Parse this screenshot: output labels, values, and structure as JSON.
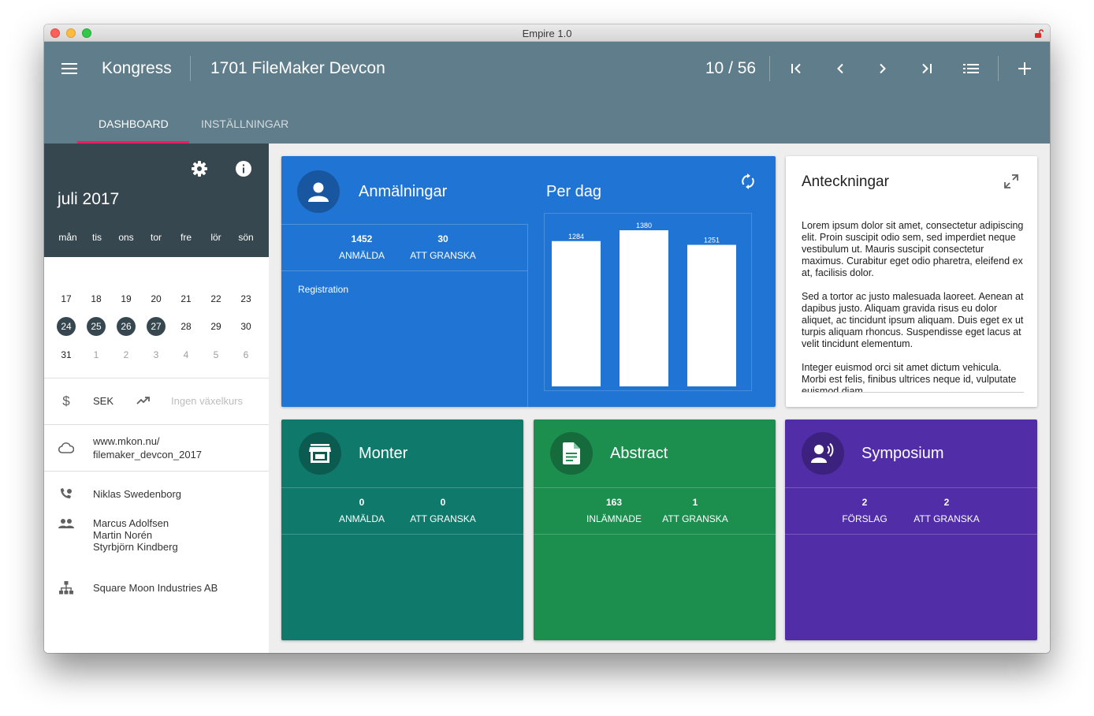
{
  "window": {
    "title": "Empire 1.0"
  },
  "appbar": {
    "app_name": "Kongress",
    "record_title": "1701  FileMaker Devcon",
    "counter": "10 / 56",
    "tabs": [
      {
        "label": "DASHBOARD",
        "active": true
      },
      {
        "label": "INSTÄLLNINGAR",
        "active": false
      }
    ],
    "background_color": "#607d8b",
    "tab_indicator_color": "#e91e63"
  },
  "calendar": {
    "month": "juli 2017",
    "weekdays": [
      "mån",
      "tis",
      "ons",
      "tor",
      "fre",
      "lör",
      "sön"
    ],
    "weeks": [
      [
        "17",
        "18",
        "19",
        "20",
        "21",
        "22",
        "23"
      ],
      [
        "24",
        "25",
        "26",
        "27",
        "28",
        "29",
        "30"
      ],
      [
        "31",
        "1",
        "2",
        "3",
        "4",
        "5",
        "6"
      ]
    ],
    "highlighted_days": [
      "24",
      "25",
      "26",
      "27"
    ],
    "next_month_days_in_last_row": [
      "1",
      "2",
      "3",
      "4",
      "5",
      "6"
    ]
  },
  "sidebar": {
    "currency": "SEK",
    "exchange_rate": "Ingen växelkurs",
    "website": [
      "www.mkon.nu/",
      "filemaker_devcon_2017"
    ],
    "contact": "Niklas Swedenborg",
    "team": [
      "Marcus Adolfsen",
      "Martin Norén",
      "Styrbjörn Kindberg"
    ],
    "organization": "Square Moon Industries AB"
  },
  "registrations": {
    "title": "Anmälningar",
    "stats": [
      {
        "value": "1452",
        "label": "ANMÄLDA"
      },
      {
        "value": "30",
        "label": "ATT GRANSKA"
      }
    ],
    "section_label": "Registration",
    "color": "#2074d4"
  },
  "per_day": {
    "title": "Per dag"
  },
  "chart_data": {
    "type": "bar",
    "title": "Per dag",
    "categories": [
      "",
      "",
      ""
    ],
    "values": [
      1284,
      1380,
      1251
    ],
    "data_labels": [
      "1284",
      "1380",
      "1251"
    ],
    "ylim": [
      0,
      1400
    ],
    "grid": false,
    "bar_color": "#ffffff"
  },
  "notes": {
    "title": "Anteckningar",
    "paragraphs": [
      "Lorem ipsum dolor sit amet, consectetur adipiscing elit. Proin suscipit odio sem, sed imperdiet neque vestibulum ut. Mauris suscipit consectetur maximus. Curabitur eget odio pharetra, eleifend ex at, facilisis dolor.",
      "Sed a tortor ac justo malesuada laoreet. Aenean at dapibus justo. Aliquam gravida risus eu dolor aliquet, ac tincidunt ipsum aliquam. Duis eget ex ut turpis aliquam rhoncus. Suspendisse eget lacus at velit tincidunt elementum.",
      "Integer euismod orci sit amet dictum vehicula. Morbi est felis, finibus ultrices neque id, vulputate euismod diam."
    ]
  },
  "booths": {
    "title": "Monter",
    "stats": [
      {
        "value": "0",
        "label": "ANMÄLDA"
      },
      {
        "value": "0",
        "label": "ATT GRANSKA"
      }
    ],
    "color": "#0f7a6b"
  },
  "abstracts": {
    "title": "Abstract",
    "stats": [
      {
        "value": "163",
        "label": "INLÄMNADE"
      },
      {
        "value": "1",
        "label": "ATT GRANSKA"
      }
    ],
    "color": "#1c8f4f"
  },
  "symposium": {
    "title": "Symposium",
    "stats": [
      {
        "value": "2",
        "label": "FÖRSLAG"
      },
      {
        "value": "2",
        "label": "ATT GRANSKA"
      }
    ],
    "color": "#512da8"
  }
}
